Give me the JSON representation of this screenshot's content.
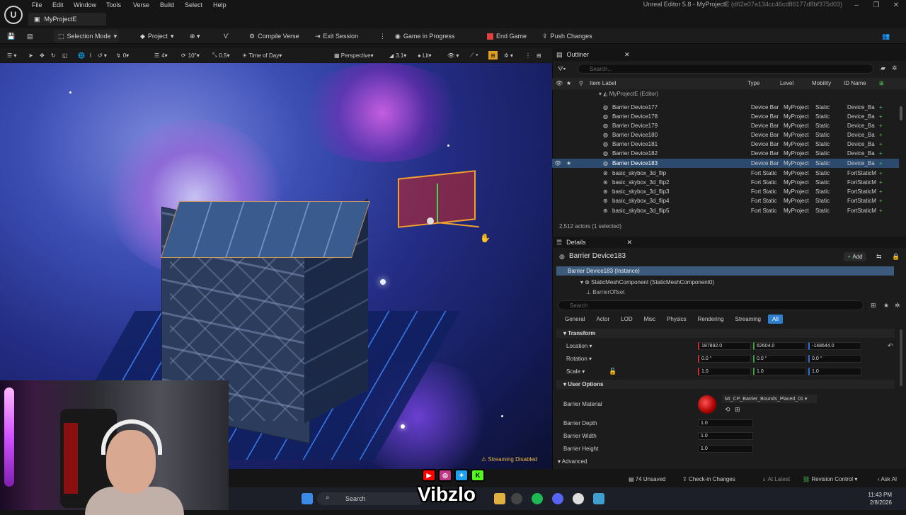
{
  "window": {
    "title": "Unreal Editor 5.8 - MyProjectE",
    "title_hash": "(d62e07a134cc46cd86177d8bf375d03)",
    "project_tab": "MyProjectE"
  },
  "menu": [
    "File",
    "Edit",
    "Window",
    "Tools",
    "Verse",
    "Build",
    "Select",
    "Help"
  ],
  "toolbar": {
    "selection_mode": "Selection Mode",
    "project": "Project",
    "compile_verse": "Compile Verse",
    "exit_session": "Exit Session",
    "game_in_progress": "Game in Progress",
    "end_game": "End Game",
    "push_changes": "Push Changes"
  },
  "viewport": {
    "snap_grid": "10",
    "rotate_snap": "10°",
    "scale_snap": "0.5",
    "counter_a": "0",
    "counter_b": "4",
    "time_of_day": "Time of Day",
    "perspective": "Perspective",
    "fov": "3.1",
    "lit": "Lit",
    "streaming": "Streaming Disabled"
  },
  "outliner": {
    "title": "Outliner",
    "search_placeholder": "Search...",
    "columns": [
      "Item Label",
      "Type",
      "Level",
      "Mobility",
      "ID Name"
    ],
    "root": "MyProjectE (Editor)",
    "rows": [
      {
        "label": "Barrier Device177",
        "type": "Device Bar",
        "level": "MyProject",
        "mobility": "Static",
        "id": "Device_Ba"
      },
      {
        "label": "Barrier Device178",
        "type": "Device Bar",
        "level": "MyProject",
        "mobility": "Static",
        "id": "Device_Ba"
      },
      {
        "label": "Barrier Device179",
        "type": "Device Bar",
        "level": "MyProject",
        "mobility": "Static",
        "id": "Device_Ba"
      },
      {
        "label": "Barrier Device180",
        "type": "Device Bar",
        "level": "MyProject",
        "mobility": "Static",
        "id": "Device_Ba"
      },
      {
        "label": "Barrier Device181",
        "type": "Device Bar",
        "level": "MyProject",
        "mobility": "Static",
        "id": "Device_Ba"
      },
      {
        "label": "Barrier Device182",
        "type": "Device Bar",
        "level": "MyProject",
        "mobility": "Static",
        "id": "Device_Ba"
      },
      {
        "label": "Barrier Device183",
        "type": "Device Bar",
        "level": "MyProject",
        "mobility": "Static",
        "id": "Device_Ba"
      },
      {
        "label": "basic_skybox_3d_flip",
        "type": "Fort Static",
        "level": "MyProject",
        "mobility": "Static",
        "id": "FortStaticM"
      },
      {
        "label": "basic_skybox_3d_flip2",
        "type": "Fort Static",
        "level": "MyProject",
        "mobility": "Static",
        "id": "FortStaticM"
      },
      {
        "label": "basic_skybox_3d_flip3",
        "type": "Fort Static",
        "level": "MyProject",
        "mobility": "Static",
        "id": "FortStaticM"
      },
      {
        "label": "basic_skybox_3d_flip4",
        "type": "Fort Static",
        "level": "MyProject",
        "mobility": "Static",
        "id": "FortStaticM"
      },
      {
        "label": "basic_skybox_3d_flip5",
        "type": "Fort Static",
        "level": "MyProject",
        "mobility": "Static",
        "id": "FortStaticM"
      }
    ],
    "actor_count": "2,512 actors (1 selected)"
  },
  "details": {
    "title": "Details",
    "name": "Barrier Device183",
    "add": "Add",
    "instance": "Barrier Device183 (Instance)",
    "component": "StaticMeshComponent (StaticMeshComponent0)",
    "sub": "BarrierOffset",
    "search_placeholder": "Search",
    "categories": [
      "General",
      "Actor",
      "LOD",
      "Misc",
      "Physics",
      "Rendering",
      "Streaming",
      "All"
    ],
    "transform_label": "Transform",
    "location_label": "Location",
    "location": [
      "187892.0",
      "62604.0",
      "-148644.0"
    ],
    "rotation_label": "Rotation",
    "rotation": [
      "0.0 °",
      "0.0 °",
      "0.0 °"
    ],
    "scale_label": "Scale",
    "scale": [
      "1.0",
      "1.0",
      "1.0"
    ],
    "user_options": "User Options",
    "barrier_material_label": "Barrier Material",
    "barrier_material": "MI_CP_Barrier_Bounds_Placed_01",
    "barrier_depth_label": "Barrier Depth",
    "barrier_depth": "1.0",
    "barrier_width_label": "Barrier Width",
    "barrier_width": "1.0",
    "barrier_height_label": "Barrier Height",
    "barrier_height": "1.0",
    "advanced": "Advanced"
  },
  "status": {
    "unsaved": "74 Unsaved",
    "checkin": "Check-in Changes",
    "at_latest": "At Latest",
    "revision": "Revision Control",
    "ask": "Ask AI"
  },
  "taskbar": {
    "search": "Search",
    "time": "11:43 PM",
    "date": "2/8/2026"
  },
  "overlay": {
    "brand": "Vibzlo"
  }
}
